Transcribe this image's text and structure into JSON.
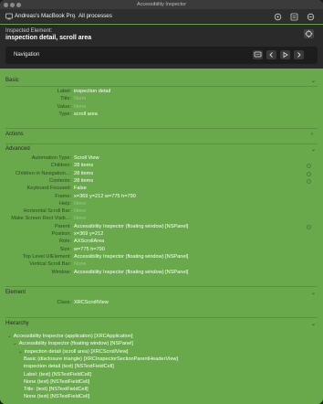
{
  "window": {
    "title": "Accessibility Inspector"
  },
  "toolbar": {
    "target_label": "Andreas's MacBook Pro",
    "separator": "〉",
    "process_label": "All processes",
    "icons": [
      "target-icon",
      "chevron-down-icon",
      "inspection-pointer-icon",
      "list-icon",
      "settings-icon"
    ]
  },
  "inspected": {
    "caption": "Inspected Element:",
    "value": "inspection detail, scroll area",
    "navigation_label": "Navigation"
  },
  "sections": {
    "basic": {
      "title": "Basic",
      "rows": [
        {
          "label": "Label:",
          "value": "inspection detail"
        },
        {
          "label": "Title:",
          "value": "None"
        },
        {
          "label": "Value:",
          "value": "None"
        },
        {
          "label": "Type:",
          "value": "scroll area"
        }
      ]
    },
    "actions": {
      "title": "Actions"
    },
    "advanced": {
      "title": "Advanced",
      "rows": [
        {
          "label": "Automation Type:",
          "value": "Scroll View"
        },
        {
          "label": "Children:",
          "value": "28 items"
        },
        {
          "label": "Children in Navigation...:",
          "value": "28 items"
        },
        {
          "label": "Contents:",
          "value": "28 items"
        },
        {
          "label": "Keyboard Focused:",
          "value": "False"
        },
        {
          "label": "Frame:",
          "value": "x=369 y=212 w=775 h=790"
        },
        {
          "label": "Help:",
          "value": "None"
        },
        {
          "label": "Horizontal Scroll Bar:",
          "value": "None"
        },
        {
          "label": "Make Screen Rect Visib...:",
          "value": "None"
        },
        {
          "label": "Parent:",
          "value": "Accessibility Inspector (floating window) [NSPanel]"
        },
        {
          "label": "Position:",
          "value": "x=369 y=212"
        },
        {
          "label": "Role:",
          "value": "AXScrollArea"
        },
        {
          "label": "Size:",
          "value": "w=775 h=790"
        },
        {
          "label": "Top Level UIElement:",
          "value": "Accessibility Inspector (floating window) [NSPanel]"
        },
        {
          "label": "Vertical Scroll Bar:",
          "value": "None"
        },
        {
          "label": "Window:",
          "value": "Accessibility Inspector (floating window) [NSPanel]"
        }
      ]
    },
    "element": {
      "title": "Element",
      "rows": [
        {
          "label": "Class:",
          "value": "XRCScrollView"
        }
      ]
    },
    "hierarchy": {
      "title": "Hierarchy",
      "nodes": [
        {
          "text": "Accessibility Inspector (application) [XRCApplication]"
        },
        {
          "text": "Accessibility Inspector (floating window) [NSPanel]"
        },
        {
          "text": "inspection detail (scroll area) [XRCScrollView]"
        },
        {
          "text": "Basic (disclosure triangle) [XRCInspectorSectionParentHeaderView]"
        },
        {
          "text": "inspection detail (text) [NSTextFieldCell]"
        },
        {
          "text": "Label: (text) [NSTextFieldCell]"
        },
        {
          "text": "None (text) [NSTextFieldCell]"
        },
        {
          "text": "Title: (text) [NSTextFieldCell]"
        },
        {
          "text": "None (text) [NSTextFieldCell]"
        }
      ]
    }
  }
}
